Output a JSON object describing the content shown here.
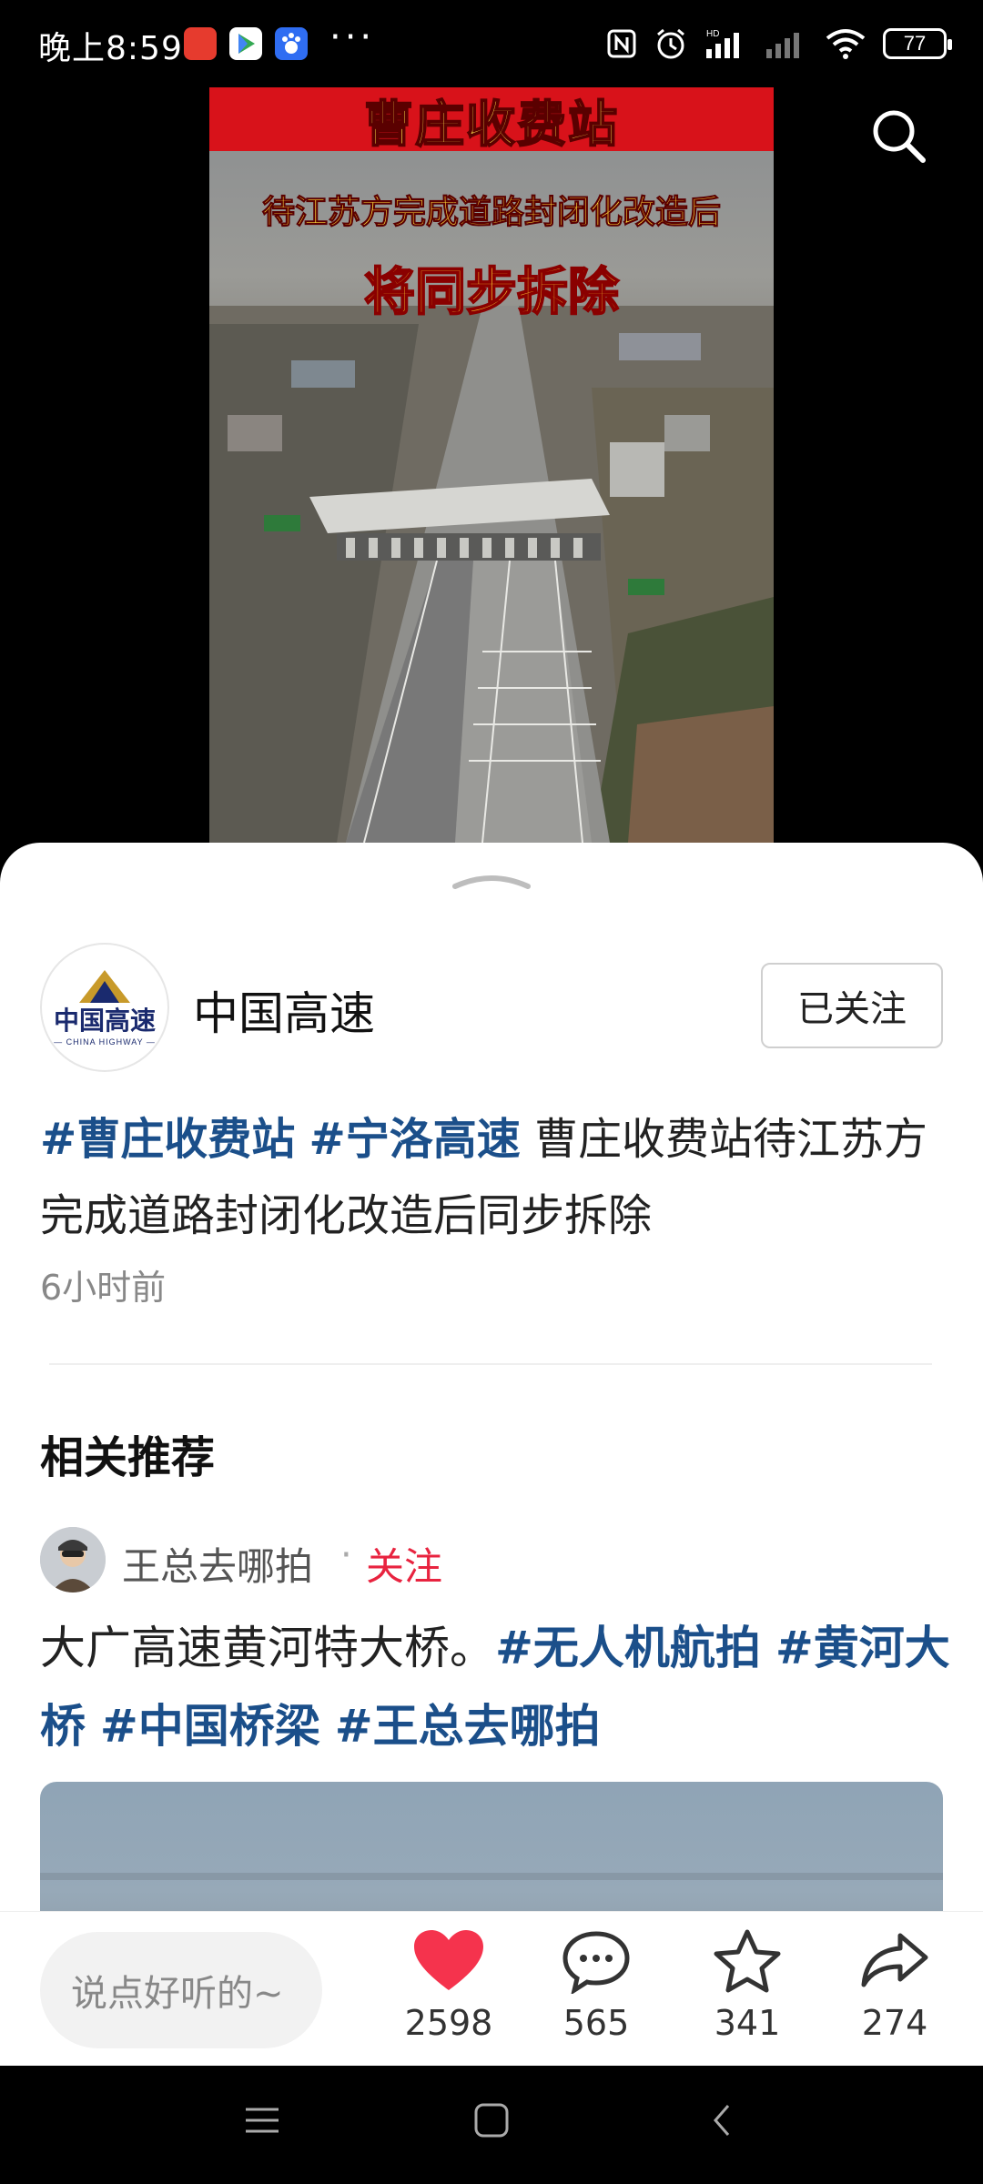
{
  "status_bar": {
    "time": "晚上8:59",
    "more": "···",
    "battery": "77"
  },
  "video": {
    "banner": "曹庄收费站",
    "subtitle_1": "待江苏方完成道路封闭化改造后",
    "subtitle_2": "将同步拆除"
  },
  "author": {
    "name": "中国高速",
    "avatar_logo": "中国高速",
    "avatar_sub": "— CHINA HIGHWAY —",
    "follow_label": "已关注"
  },
  "post": {
    "hashtags": [
      "#曹庄收费站",
      "#宁洛高速"
    ],
    "text": "曹庄收费站待江苏方完成道路封闭化改造后同步拆除",
    "time": "6小时前"
  },
  "related": {
    "title": "相关推荐",
    "item": {
      "author": "王总去哪拍",
      "dot": "·",
      "follow_label": "关注",
      "text": "大广高速黄河特大桥。",
      "hashtags": [
        "#无人机航拍",
        "#黄河大桥",
        "#中国桥梁",
        "#王总去哪拍"
      ]
    }
  },
  "actions": {
    "comment_placeholder": "说点好听的~",
    "like_count": "2598",
    "comment_count": "565",
    "favorite_count": "341",
    "share_count": "274"
  },
  "colors": {
    "hashtag": "#1b4f8a",
    "like": "#f5334d",
    "follow_red": "#e8233f",
    "banner_red": "#d8121a"
  },
  "icons": [
    "search-icon",
    "heart-icon",
    "comment-icon",
    "star-icon",
    "share-icon",
    "menu-icon",
    "home-icon",
    "back-icon"
  ]
}
